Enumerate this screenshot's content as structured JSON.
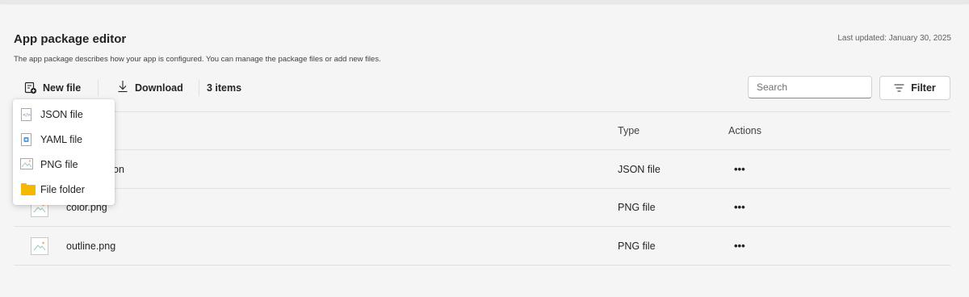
{
  "header": {
    "title": "App package editor",
    "last_updated": "Last updated: January 30, 2025",
    "description": "The app package describes how your app is configured. You can manage the package files or add new files."
  },
  "toolbar": {
    "new_file": "New file",
    "download": "Download",
    "item_count": "3 items",
    "search_placeholder": "Search",
    "filter": "Filter"
  },
  "table": {
    "columns": [
      "Type",
      "Actions"
    ],
    "rows": [
      {
        "name": "manifest.json",
        "visible_name": "on",
        "type": "JSON file",
        "icon": "json-file-icon"
      },
      {
        "name": "color.png",
        "type": "PNG file",
        "icon": "png-file-icon"
      },
      {
        "name": "outline.png",
        "type": "PNG file",
        "icon": "png-file-icon"
      }
    ],
    "actions_label": "•••"
  },
  "new_file_menu": {
    "items": [
      {
        "label": "JSON file",
        "icon": "json-file-icon"
      },
      {
        "label": "YAML file",
        "icon": "yaml-file-icon"
      },
      {
        "label": "PNG file",
        "icon": "png-file-icon"
      },
      {
        "label": "File folder",
        "icon": "folder-icon"
      }
    ]
  },
  "colors": {
    "background": "#f5f5f5",
    "folder": "#f5b800",
    "divider": "#e0e0e0"
  }
}
